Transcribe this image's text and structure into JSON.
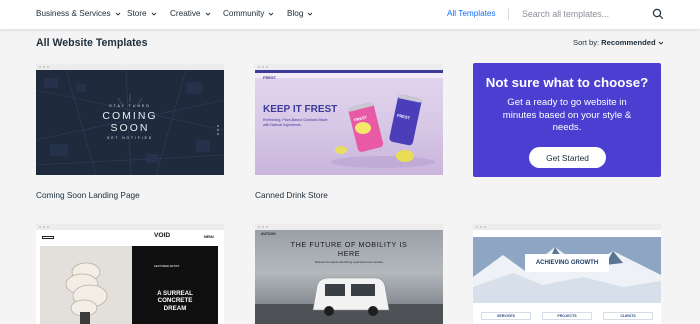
{
  "nav": {
    "items": [
      {
        "label": "Business & Services"
      },
      {
        "label": "Store"
      },
      {
        "label": "Creative"
      },
      {
        "label": "Community"
      },
      {
        "label": "Blog"
      }
    ],
    "all_templates": "All Templates",
    "search_placeholder": "Search all templates..."
  },
  "heading": {
    "title": "All Website Templates",
    "sort_label": "Sort by:",
    "sort_value": "Recommended"
  },
  "cards": [
    {
      "name": "Coming Soon Landing Page",
      "thumb": {
        "line1": "STAY TUNED",
        "line2": "COMING",
        "line3": "SOON",
        "line4": "GET NOTIFIED"
      }
    },
    {
      "name": "Canned Drink Store",
      "thumb": {
        "logo": "FREST",
        "headline": "KEEP IT FREST",
        "sub": "Refreshing, Plant-Based Cocktails Made with Natural Ingredients",
        "can_text": "FREST"
      }
    }
  ],
  "promo": {
    "title": "Not sure what to choose?",
    "body": "Get a ready to go website in minutes based on your style & needs.",
    "button": "Get Started"
  },
  "bottom_cards": [
    {
      "logo": "VOID",
      "menu": "MENU",
      "text": "A SURREAL CONCRETE DREAM",
      "small": "FEATURED ARTIST"
    },
    {
      "logo": "AUTOGO",
      "headline": "THE FUTURE OF MOBILITY IS HERE",
      "sub": "Discover the latest self-driving experience from AutoGo"
    },
    {
      "headline": "ACHIEVING GROWTH",
      "services": [
        "SERVICES",
        "PROJECTS",
        "CLIENTS"
      ]
    }
  ],
  "colors": {
    "accent": "#116dff",
    "promo": "#4a3fd1",
    "text": "#20303c"
  }
}
